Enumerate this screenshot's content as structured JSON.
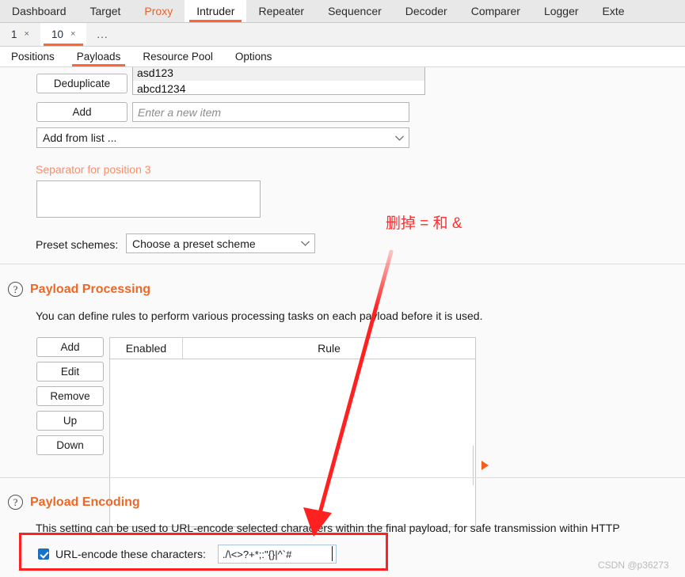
{
  "main_tabs": [
    {
      "label": "Dashboard",
      "state": "normal"
    },
    {
      "label": "Target",
      "state": "normal"
    },
    {
      "label": "Proxy",
      "state": "highlight"
    },
    {
      "label": "Intruder",
      "state": "selected"
    },
    {
      "label": "Repeater",
      "state": "normal"
    },
    {
      "label": "Sequencer",
      "state": "normal"
    },
    {
      "label": "Decoder",
      "state": "normal"
    },
    {
      "label": "Comparer",
      "state": "normal"
    },
    {
      "label": "Logger",
      "state": "normal"
    },
    {
      "label": "Exte",
      "state": "normal"
    }
  ],
  "attack_tabs": [
    {
      "label": "1",
      "close": "×",
      "selected": false
    },
    {
      "label": "10",
      "close": "×",
      "selected": true
    }
  ],
  "attack_tabs_more": "...",
  "inner_tabs": [
    {
      "label": "Positions",
      "selected": false
    },
    {
      "label": "Payloads",
      "selected": true
    },
    {
      "label": "Resource Pool",
      "selected": false
    },
    {
      "label": "Options",
      "selected": false
    }
  ],
  "payload_options": {
    "deduplicate_label": "Deduplicate",
    "add_label": "Add",
    "new_item_placeholder": "Enter a new item",
    "new_item_value": "",
    "add_from_list_label": "Add from list ...",
    "list_items": [
      "asd123",
      "abcd1234"
    ]
  },
  "separator": {
    "label": "Separator for position 3",
    "value": ""
  },
  "preset": {
    "label": "Preset schemes:",
    "selected_option": "Choose a preset scheme"
  },
  "payload_processing": {
    "help_glyph": "?",
    "title": "Payload Processing",
    "description": "You can define rules to perform various processing tasks on each payload before it is used.",
    "buttons": [
      "Add",
      "Edit",
      "Remove",
      "Up",
      "Down"
    ],
    "table_headers": [
      "Enabled",
      "Rule"
    ],
    "rows": []
  },
  "payload_encoding": {
    "help_glyph": "?",
    "title": "Payload Encoding",
    "description": "This setting can be used to URL-encode selected characters within the final payload, for safe transmission within HTTP",
    "checkbox_checked": true,
    "checkbox_label": "URL-encode these characters:",
    "characters_value": "./\\<>?+*;:\"{}|^`#"
  },
  "annotation": {
    "note_text": "删掉 = 和 &",
    "arrow_color": "#ff2020",
    "highlight_box_color": "#ff2020"
  },
  "watermark": "CSDN @p36273",
  "colors": {
    "accent_orange": "#ff6633",
    "section_orange": "#f06724",
    "disabled_orange": "#fb8e6a",
    "annotation_red": "#ff2020",
    "checkbox_blue": "#1a73c8"
  }
}
